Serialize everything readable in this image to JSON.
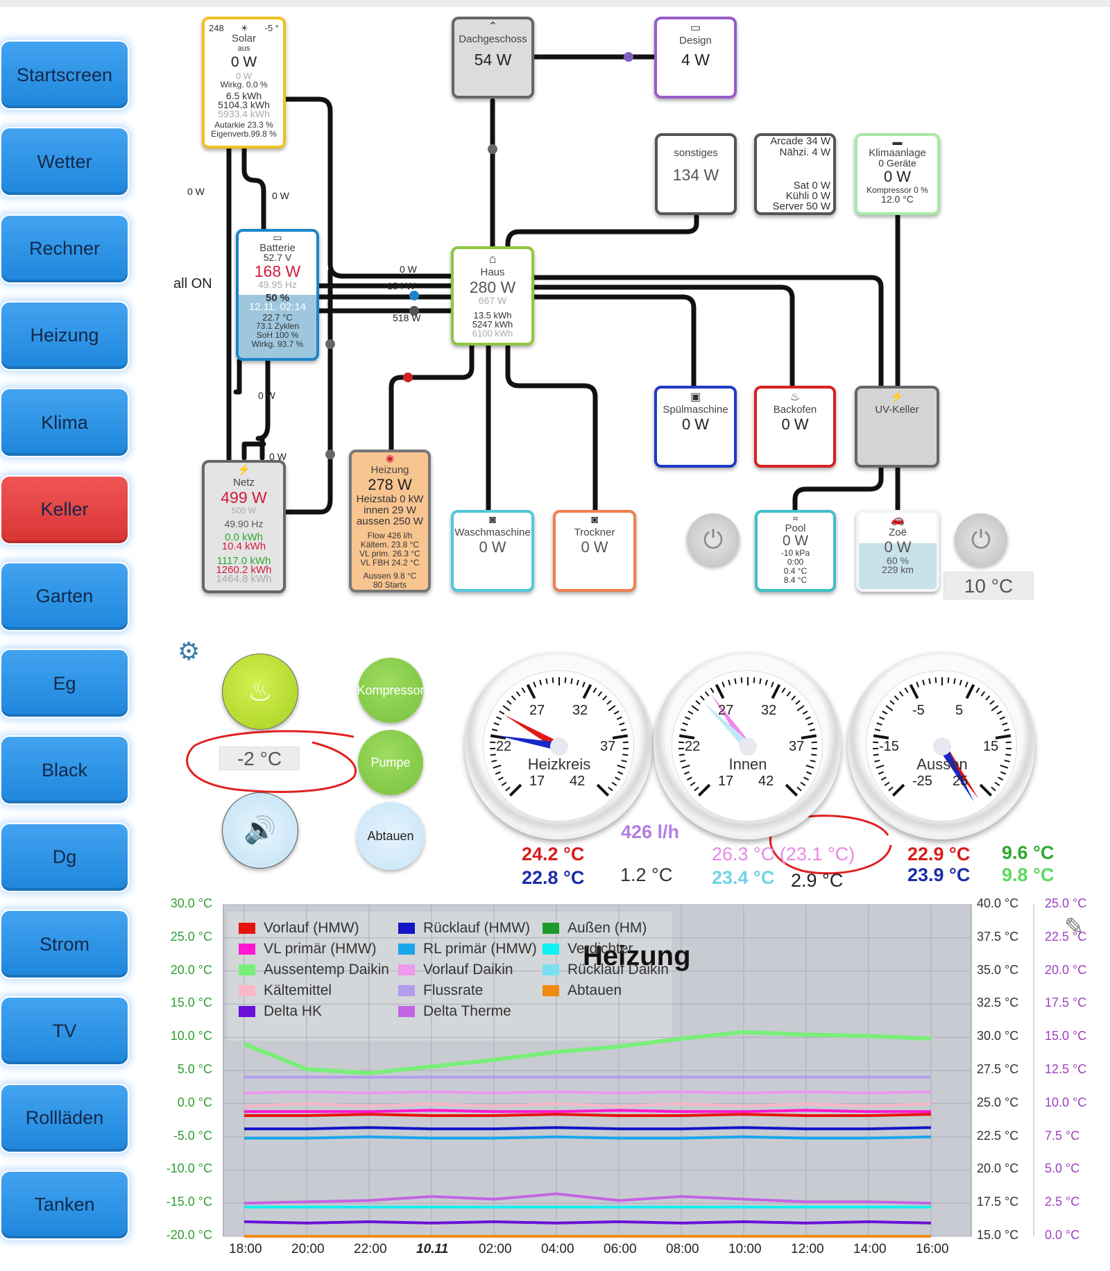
{
  "nav": {
    "items": [
      "Startscreen",
      "Wetter",
      "Rechner",
      "Heizung",
      "Klima",
      "Keller",
      "Garten",
      "Eg",
      "Black",
      "Dg",
      "Strom",
      "TV",
      "Rollläden",
      "Tanken"
    ],
    "active": "Keller"
  },
  "solar": {
    "top_left": "248",
    "top_right": "-5 °",
    "title": "Solar",
    "status": "aus",
    "power": "0 W",
    "power2": "0 W",
    "wirkg": "Wirkg. 0.0 %",
    "kwh1": "6.5 kWh",
    "kwh2": "5104.3 kWh",
    "kwh3": "5933.4 kWh",
    "autarkie": "Autarkie 23.3 %",
    "eigen": "Eigenverb.99.8 %"
  },
  "dach": {
    "title": "Dachgeschoss",
    "power": "54 W"
  },
  "design": {
    "title": "Design",
    "power": "4 W"
  },
  "sonstiges": {
    "title": "sonstiges",
    "power": "134 W"
  },
  "arcade": {
    "l1": "Arcade 34 W",
    "l2": "Nähzi. 4 W",
    "l3": "Sat 0 W",
    "l4": "Kühli 0 W",
    "l5": "Server 50 W"
  },
  "klima": {
    "title": "Klimaanlage",
    "devices": "0 Geräte",
    "power": "0 W",
    "kompressor": "Kompressor 0 %",
    "temp": "12.0 °C"
  },
  "batterie": {
    "title": "Batterie",
    "volt": "52.7 V",
    "power": "168 W",
    "hz": "49.95 Hz",
    "pct": "50 %",
    "date": "12.11. 02:14",
    "temp": "22.7 °C",
    "zyklen": "73.1 Zyklen",
    "soh": "SoH 100 %",
    "wirkg": "Wirkg. 93.7 %"
  },
  "haus": {
    "title": "Haus",
    "power": "280 W",
    "power2": "667 W",
    "kwh1": "13.5 kWh",
    "kwh2": "5247 kWh",
    "kwh3": "6100 kWh"
  },
  "netz": {
    "title": "Netz",
    "power": "499 W",
    "power2": "500 W",
    "hz": "49.90 Hz",
    "kwh1": "0.0 kWh",
    "kwh2": "10.4 kWh",
    "kwh3": "1117.0 kWh",
    "kwh4": "1260.2 kWh",
    "kwh5": "1464.8 kWh"
  },
  "heizung": {
    "title": "Heizung",
    "power": "278 W",
    "l1": "Heizstab 0 kW",
    "l2": "innen 29 W",
    "l3": "aussen 250 W",
    "l4": "Flow 426 l/h",
    "l5": "Kältem. 23.8 °C",
    "l6": "VL prim. 26.3 °C",
    "l7": "VL FBH 24.2 °C",
    "l8": "Aussen 9.8 °C",
    "l9": "80 Starts"
  },
  "spuel": {
    "title": "Spülmaschine",
    "power": "0 W"
  },
  "backofen": {
    "title": "Backofen",
    "power": "0 W"
  },
  "uvkeller": {
    "title": "UV-Keller"
  },
  "wasch": {
    "title": "Waschmaschine",
    "power": "0 W"
  },
  "trockner": {
    "title": "Trockner",
    "power": "0 W"
  },
  "pool": {
    "title": "Pool",
    "power": "0 W",
    "l1": "-10 kPa",
    "l2": "0:00",
    "l3": "0.4 °C",
    "l4": "8.4 °C"
  },
  "zoe": {
    "title": "Zoë",
    "power": "0 W",
    "pct": "60 %",
    "km": "229 km"
  },
  "wire_labels": {
    "a": "0 W",
    "b": "0 W",
    "c": "all ON",
    "d": "0 W",
    "e": "184 W",
    "f": "518 W",
    "g": "0 W",
    "h": "0 W"
  },
  "outside_temp": "10 °C",
  "controls": {
    "setpoint": "-2 °C",
    "kompressor": "Kompressor",
    "pumpe": "Pumpe",
    "abtauen": "Abtauen",
    "colors": {
      "green": "#b4dc3c",
      "gray_green": "#8fcf4e",
      "blue": "#cfe6f7"
    }
  },
  "gauges": [
    {
      "label": "Heizkreis",
      "ticks": [
        "17",
        "22",
        "27",
        "32",
        "37",
        "42"
      ]
    },
    {
      "label": "Innen",
      "ticks": [
        "17",
        "22",
        "27",
        "32",
        "37",
        "42"
      ]
    },
    {
      "label": "Aussen",
      "ticks": [
        "-25",
        "-15",
        "-5",
        "5",
        "15",
        "25"
      ]
    }
  ],
  "readings": {
    "flow": "426 l/h",
    "h_red": "24.2 °C",
    "h_blue": "22.8 °C",
    "delta": "1.2 °C",
    "i_pink": "26.3 °C (23.1 °C)",
    "i_cyan": "23.4 °C",
    "i_dark": "2.9 °C",
    "a_red": "22.9 °C",
    "a_blue": "23.9 °C",
    "a_green1": "9.6 °C",
    "a_green2": "9.8 °C"
  },
  "chart_data": {
    "type": "line",
    "title": "Heizung",
    "xlabel": "",
    "ylabel": "",
    "x": [
      "18:00",
      "20:00",
      "22:00",
      "10.11",
      "02:00",
      "04:00",
      "06:00",
      "08:00",
      "10:00",
      "12:00",
      "14:00",
      "16:00"
    ],
    "y_left_ticks": [
      "30.0 °C",
      "25.0 °C",
      "20.0 °C",
      "15.0 °C",
      "10.0 °C",
      "5.0 °C",
      "0.0 °C",
      "-5.0 °C",
      "-10.0 °C",
      "-15.0 °C",
      "-20.0 °C"
    ],
    "y_right1_ticks": [
      "40.0 °C",
      "37.5 °C",
      "35.0 °C",
      "32.5 °C",
      "30.0 °C",
      "27.5 °C",
      "25.0 °C",
      "22.5 °C",
      "20.0 °C",
      "17.5 °C",
      "15.0 °C"
    ],
    "y_right2_ticks": [
      "25.0 °C",
      "22.5 °C",
      "20.0 °C",
      "17.5 °C",
      "15.0 °C",
      "12.5 °C",
      "10.0 °C",
      "7.5 °C",
      "5.0 °C",
      "2.5 °C",
      "0.0 °C"
    ],
    "ylim_left": [
      -20,
      30
    ],
    "ylim_right1": [
      15,
      40
    ],
    "ylim_right2": [
      0,
      25
    ],
    "grid": true,
    "legend": "top-left",
    "legend_entries": [
      {
        "name": "Vorlauf (HMW)",
        "color": "#e8120c"
      },
      {
        "name": "Rücklauf (HMW)",
        "color": "#1414c8"
      },
      {
        "name": "Außen (HM)",
        "color": "#1e9a2a"
      },
      {
        "name": "VL primär (HMW)",
        "color": "#ff18d0"
      },
      {
        "name": "RL primär (HMW)",
        "color": "#1aa6ea"
      },
      {
        "name": "Verdichter",
        "color": "#10f0f0"
      },
      {
        "name": "Aussentemp Daikin",
        "color": "#7aee7a"
      },
      {
        "name": "Vorlauf Daikin",
        "color": "#ee98ee"
      },
      {
        "name": "Rücklauf Daikin",
        "color": "#7adff0"
      },
      {
        "name": "Kältemittel",
        "color": "#f8b8c8"
      },
      {
        "name": "Flussrate",
        "color": "#b49cec"
      },
      {
        "name": "Abtauen",
        "color": "#f08a10"
      },
      {
        "name": "Delta HK",
        "color": "#6a10d8"
      },
      {
        "name": "Delta Therme",
        "color": "#c464e4"
      }
    ],
    "series": [
      {
        "name": "Aussentemp Daikin",
        "axis": "right1",
        "values": [
          29.5,
          27.6,
          27.3,
          27.8,
          28.3,
          28.9,
          29.3,
          29.9,
          30.4,
          30.2,
          30.1,
          29.9
        ]
      },
      {
        "name": "Vorlauf Daikin",
        "axis": "right1",
        "values": [
          25.8,
          25.9,
          25.8,
          25.9,
          25.8,
          25.9,
          25.8,
          25.9,
          25.8,
          25.9,
          25.8,
          25.9
        ]
      },
      {
        "name": "Kältemittel",
        "axis": "right1",
        "values": [
          24.8,
          25.0,
          24.8,
          25.0,
          24.8,
          25.0,
          24.8,
          25.0,
          24.8,
          25.0,
          24.8,
          25.0
        ]
      },
      {
        "name": "VL primär (HMW)",
        "axis": "right1",
        "values": [
          24.4,
          24.4,
          24.4,
          24.5,
          24.4,
          24.4,
          24.5,
          24.4,
          24.4,
          24.5,
          24.4,
          24.4
        ]
      },
      {
        "name": "Vorlauf (HMW)",
        "axis": "right1",
        "values": [
          24.1,
          24.1,
          24.2,
          24.1,
          24.1,
          24.2,
          24.1,
          24.1,
          24.2,
          24.1,
          24.1,
          24.2
        ]
      },
      {
        "name": "Rücklauf (HMW)",
        "axis": "right1",
        "values": [
          23.1,
          23.1,
          23.2,
          23.1,
          23.1,
          23.2,
          23.1,
          23.1,
          23.2,
          23.1,
          23.1,
          23.2
        ]
      },
      {
        "name": "RL primär (HMW)",
        "axis": "right1",
        "values": [
          22.4,
          22.4,
          22.5,
          22.4,
          22.4,
          22.5,
          22.4,
          22.4,
          22.5,
          22.4,
          22.4,
          22.5
        ]
      },
      {
        "name": "Flussrate",
        "axis": "right2",
        "values": [
          12.0,
          12.0,
          12.0,
          12.0,
          12.0,
          12.0,
          12.0,
          12.0,
          12.0,
          12.0,
          12.0,
          12.0
        ]
      },
      {
        "name": "Delta Therme",
        "axis": "right2",
        "values": [
          2.5,
          2.6,
          2.7,
          3.0,
          2.8,
          3.2,
          2.7,
          3.0,
          2.8,
          2.6,
          2.6,
          2.5
        ]
      },
      {
        "name": "Verdichter",
        "axis": "right2",
        "values": [
          2.2,
          2.2,
          2.2,
          2.2,
          2.2,
          2.2,
          2.2,
          2.2,
          2.2,
          2.2,
          2.2,
          2.2
        ]
      },
      {
        "name": "Delta HK",
        "axis": "right2",
        "values": [
          1.1,
          1.0,
          1.1,
          1.0,
          1.1,
          1.0,
          1.1,
          1.0,
          1.1,
          1.0,
          1.1,
          1.0
        ]
      },
      {
        "name": "Abtauen",
        "axis": "right2",
        "values": [
          0,
          0,
          0,
          0,
          0,
          0,
          0,
          0,
          0,
          0,
          0,
          0
        ]
      }
    ]
  }
}
